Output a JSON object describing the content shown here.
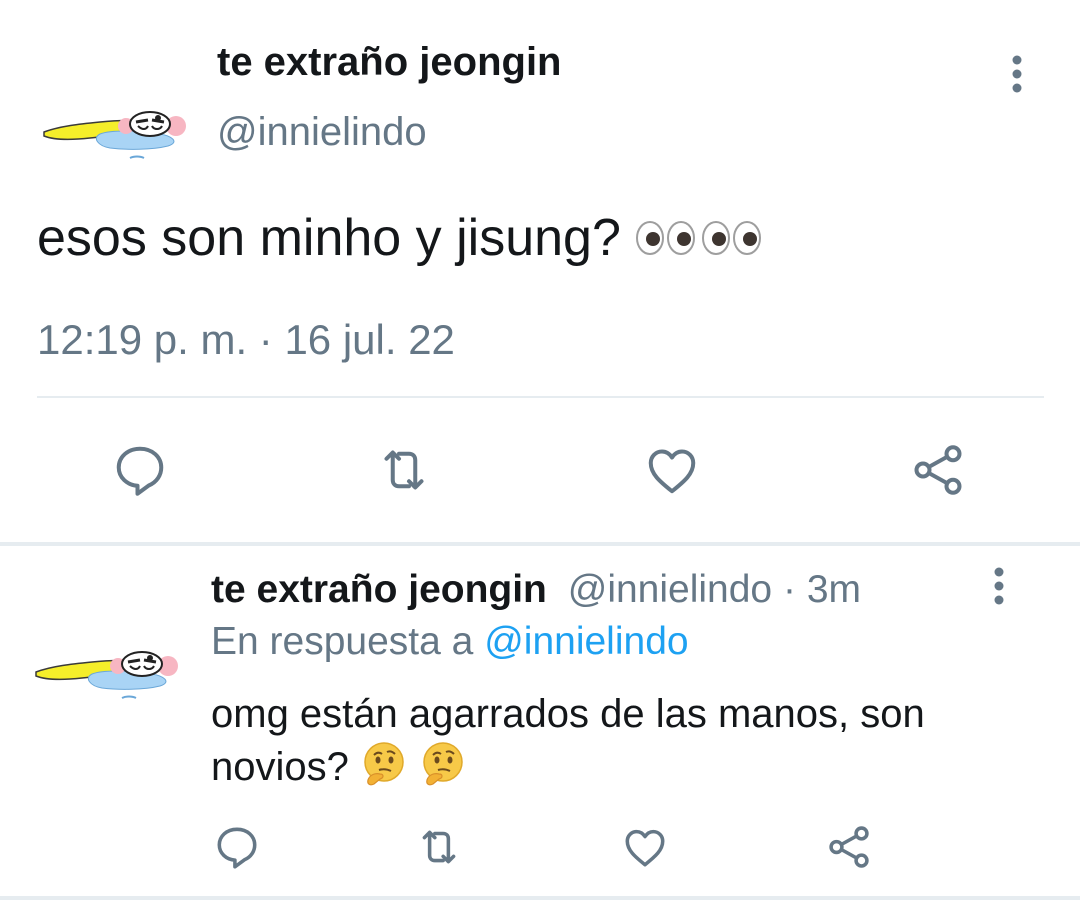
{
  "main_tweet": {
    "display_name": "te extraño jeongin",
    "handle": "@innielindo",
    "text": "esos son minho y jisung?",
    "emoji": "eyes-emoji x2",
    "timestamp": "12:19 p. m. · 16 jul. 22",
    "actions": [
      "reply",
      "retweet",
      "like",
      "share"
    ]
  },
  "reply_tweet": {
    "display_name": "te extraño jeongin",
    "handle": "@innielindo",
    "separator": "·",
    "time": "3m",
    "reply_prefix": "En respuesta a",
    "reply_to_handle": "@innielindo",
    "text": "omg están agarrados de las manos, son novios?",
    "emoji": "thinking-face-emoji x2",
    "actions": [
      "reply",
      "retweet",
      "like",
      "share"
    ]
  },
  "colors": {
    "primary_text": "#14171a",
    "secondary_text": "#657786",
    "link": "#1da1f2",
    "divider": "#e6ecf0",
    "icon": "#657786"
  }
}
